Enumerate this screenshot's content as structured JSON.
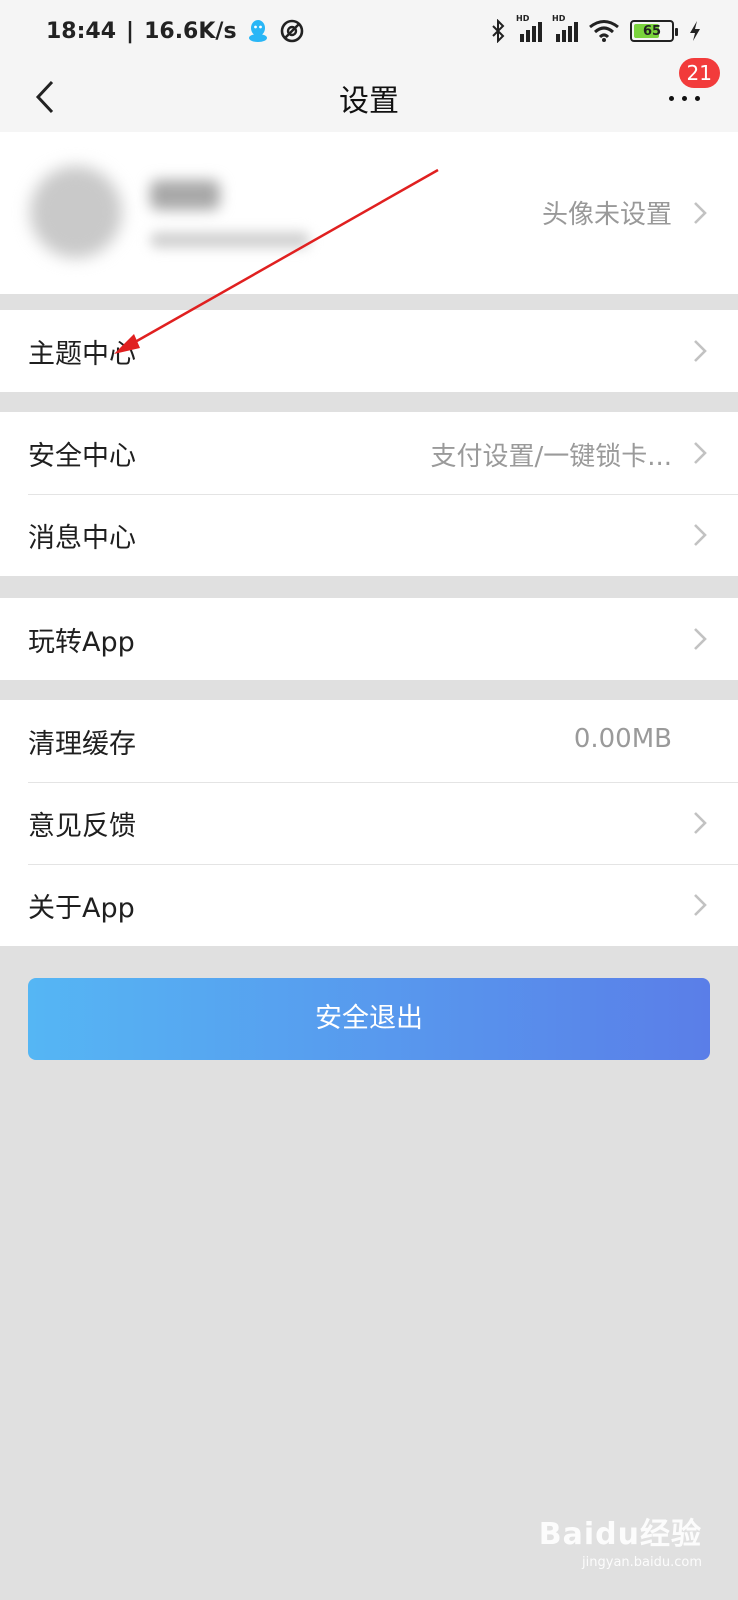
{
  "status_bar": {
    "time": "18:44",
    "speed": "16.6K/s",
    "separator": "|",
    "battery_level": "65",
    "hd_label": "HD"
  },
  "nav": {
    "title": "设置",
    "badge_count": "21"
  },
  "profile": {
    "hint": "头像未设置"
  },
  "groups": [
    {
      "items": [
        {
          "label": "主题中心",
          "value": ""
        }
      ]
    },
    {
      "items": [
        {
          "label": "安全中心",
          "value": "支付设置/一键锁卡..."
        },
        {
          "label": "消息中心",
          "value": ""
        }
      ]
    },
    {
      "items": [
        {
          "label": "玩转App",
          "value": ""
        }
      ]
    },
    {
      "items": [
        {
          "label": "清理缓存",
          "value": "0.00MB"
        },
        {
          "label": "意见反馈",
          "value": ""
        },
        {
          "label": "关于App",
          "value": ""
        }
      ]
    }
  ],
  "logout_label": "安全退出",
  "watermark": {
    "logo": "Baidu经验",
    "url": "jingyan.baidu.com"
  },
  "colors": {
    "badge": "#f23b3b",
    "logout_gradient_start": "#55b6f4",
    "logout_gradient_end": "#5a7ee8",
    "annotation_arrow": "#e02020"
  }
}
